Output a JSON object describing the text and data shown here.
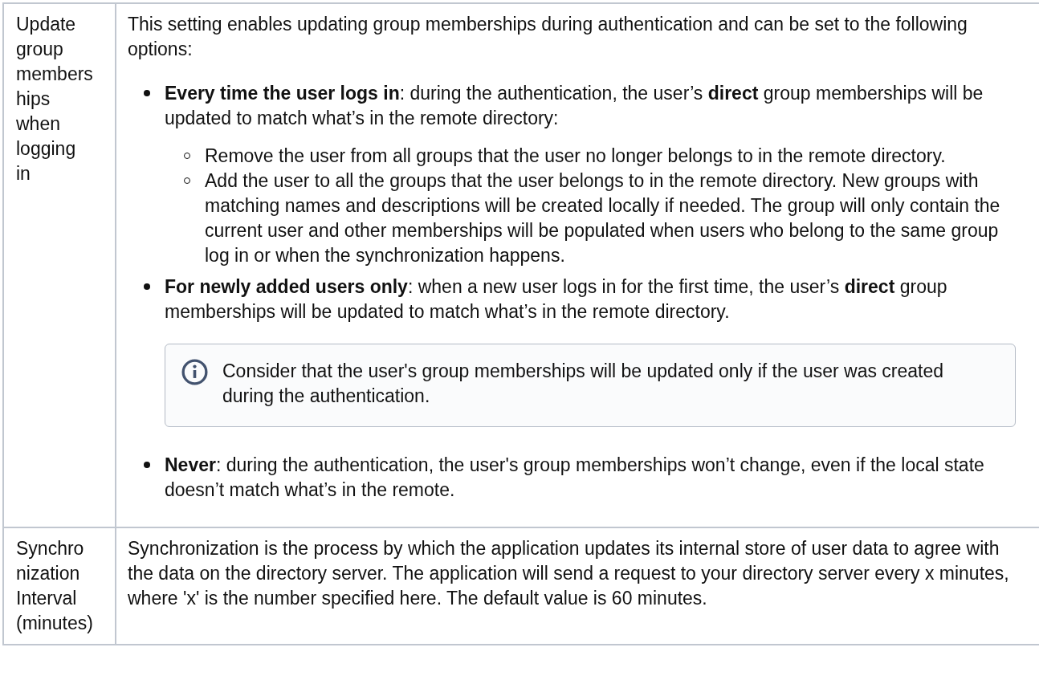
{
  "table": {
    "rows": [
      {
        "label": "Update group memberships when logging in",
        "intro": "This setting enables updating group memberships during authentication and can be set to the following options:",
        "options": [
          {
            "text": "**Every time the user logs in**: during the authentication, the user’s **direct** group memberships will be updated to match what’s in the remote directory:",
            "sub": [
              "Remove the user from all groups that the user no longer belongs to in the remote directory.",
              "Add the user to all the groups that the user belongs to in the remote directory. New groups with matching names and descriptions will be created locally if needed. The group will only contain the current user and other memberships will be populated when users who belong to the same group log in or when the synchronization happens."
            ]
          },
          {
            "text": "**For newly added users only**: when a new user logs in for the first time, the user’s **direct** group memberships will be updated to match what’s in the remote directory.",
            "note": "Consider that the user's group memberships will be updated only if the user was created during the authentication."
          },
          {
            "text": "**Never**: during the authentication, the user's group memberships won’t change, even if the local state doesn’t match what’s in the remote."
          }
        ]
      },
      {
        "label": "Synchronization Interval (minutes)",
        "intro": "Synchronization is the process by which the application updates its internal store of user data to agree with the data on the directory server. The application will send a request to your directory server every x minutes, where 'x' is the number specified here. The default value is 60 minutes."
      }
    ]
  }
}
